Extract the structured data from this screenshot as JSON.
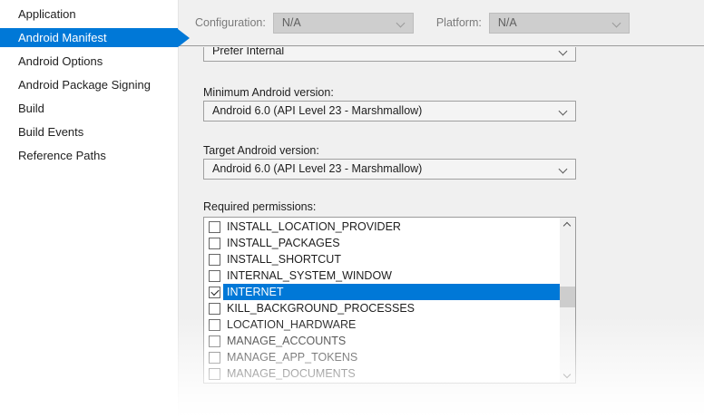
{
  "sidebar": {
    "items": [
      {
        "label": "Application",
        "selected": false
      },
      {
        "label": "Android Manifest",
        "selected": true
      },
      {
        "label": "Android Options",
        "selected": false
      },
      {
        "label": "Android Package Signing",
        "selected": false
      },
      {
        "label": "Build",
        "selected": false
      },
      {
        "label": "Build Events",
        "selected": false
      },
      {
        "label": "Reference Paths",
        "selected": false
      }
    ]
  },
  "header": {
    "configuration_label": "Configuration:",
    "configuration_value": "N/A",
    "platform_label": "Platform:",
    "platform_value": "N/A"
  },
  "form": {
    "install_location_value": "Prefer Internal",
    "min_version_label": "Minimum Android version:",
    "min_version_value": "Android 6.0 (API Level 23 - Marshmallow)",
    "target_version_label": "Target Android version:",
    "target_version_value": "Android 6.0 (API Level 23 - Marshmallow)",
    "permissions_label": "Required permissions:",
    "permissions": [
      {
        "name": "INSTALL_LOCATION_PROVIDER",
        "checked": false,
        "selected": false
      },
      {
        "name": "INSTALL_PACKAGES",
        "checked": false,
        "selected": false
      },
      {
        "name": "INSTALL_SHORTCUT",
        "checked": false,
        "selected": false
      },
      {
        "name": "INTERNAL_SYSTEM_WINDOW",
        "checked": false,
        "selected": false
      },
      {
        "name": "INTERNET",
        "checked": true,
        "selected": true
      },
      {
        "name": "KILL_BACKGROUND_PROCESSES",
        "checked": false,
        "selected": false
      },
      {
        "name": "LOCATION_HARDWARE",
        "checked": false,
        "selected": false
      },
      {
        "name": "MANAGE_ACCOUNTS",
        "checked": false,
        "selected": false
      },
      {
        "name": "MANAGE_APP_TOKENS",
        "checked": false,
        "selected": false
      },
      {
        "name": "MANAGE_DOCUMENTS",
        "checked": false,
        "selected": false
      }
    ]
  },
  "icons": {
    "combo_chevron": "chevron-down",
    "scroll_up": "chevron-up",
    "scroll_down": "chevron-down",
    "selected_nav": "arrow-right"
  },
  "colors": {
    "accent": "#0078d7",
    "selection_text": "#ffffff",
    "panel_bg": "#f0f0f0",
    "sidebar_bg": "#ffffff",
    "divider": "#9b9b9b",
    "listbox_bg": "#ffffff",
    "disabled_combo_bg": "#cecece",
    "scroll_thumb": "#cdcdcd"
  }
}
